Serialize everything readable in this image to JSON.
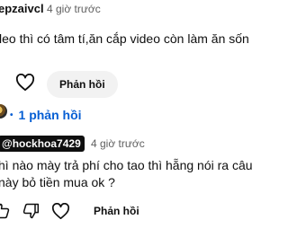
{
  "comment1": {
    "username": "epzaivcl",
    "time": "4 giờ trước",
    "text": "leo thì có tâm tí,ăn cắp video còn làm ăn sốn",
    "reply_label": "Phản hồi"
  },
  "replies": {
    "label": "1 phản hồi",
    "color": "#065fd4"
  },
  "reply1": {
    "username": "@hockhoa7429",
    "time": "4 giờ trước",
    "text_line1": "hì nào mày trả phí cho tao thì hẵng nói ra câu",
    "text_line2": "này bỏ tiền mua ok ?",
    "reply_label": "Phản hồi"
  }
}
